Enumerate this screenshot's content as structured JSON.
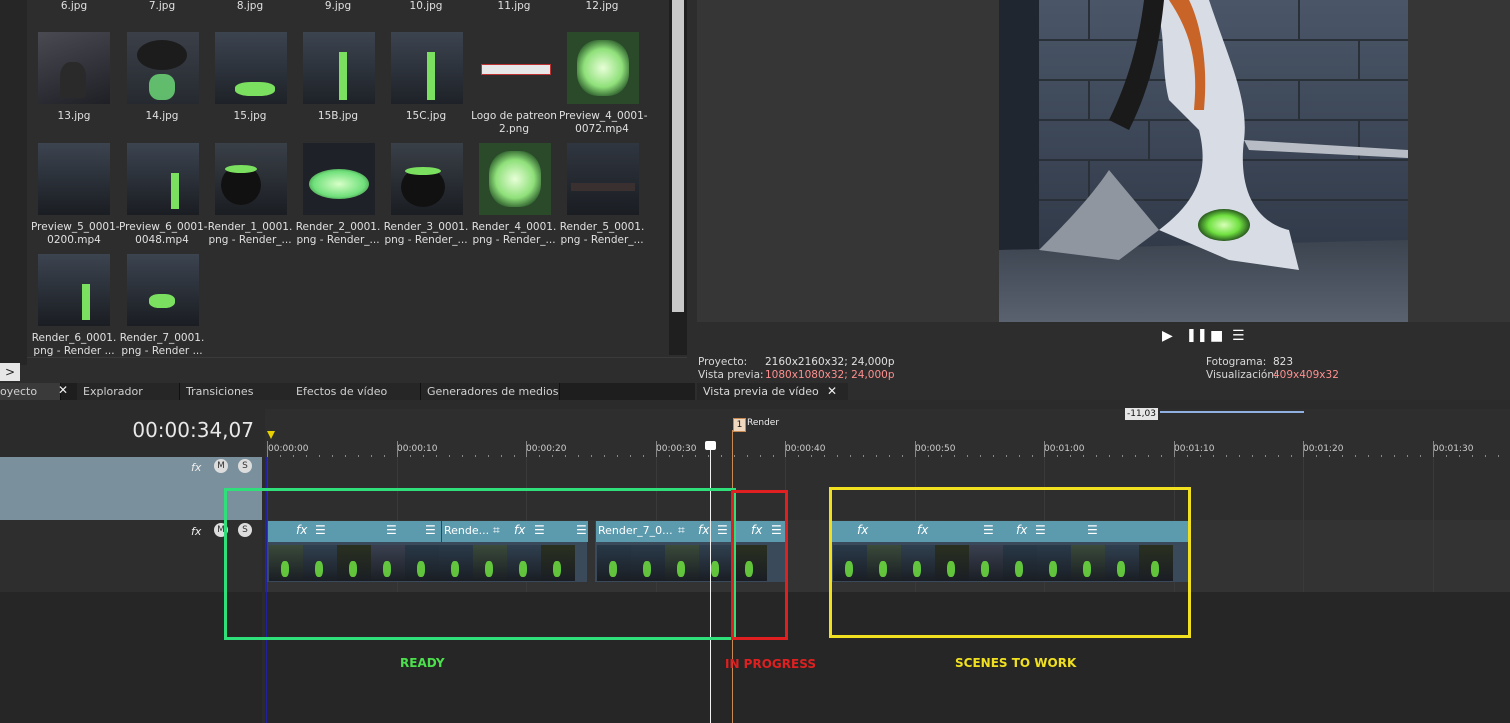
{
  "media": {
    "files": [
      {
        "name": "6.jpg"
      },
      {
        "name": "7.jpg"
      },
      {
        "name": "8.jpg"
      },
      {
        "name": "9.jpg"
      },
      {
        "name": "10.jpg"
      },
      {
        "name": "11.jpg"
      },
      {
        "name": "12.jpg"
      },
      {
        "name": "13.jpg"
      },
      {
        "name": "14.jpg"
      },
      {
        "name": "15.jpg"
      },
      {
        "name": "15B.jpg"
      },
      {
        "name": "15C.jpg"
      },
      {
        "name": "Logo de patreon\n2.png"
      },
      {
        "name": "Preview_4_0001-\n0072.mp4"
      },
      {
        "name": "Preview_5_0001-\n0200.mp4"
      },
      {
        "name": "Preview_6_0001-\n0048.mp4"
      },
      {
        "name": "Render_1_0001.\npng - Render_..."
      },
      {
        "name": "Render_2_0001.\npng - Render_..."
      },
      {
        "name": "Render_3_0001.\npng - Render_..."
      },
      {
        "name": "Render_4_0001.\npng - Render_..."
      },
      {
        "name": "Render_5_0001.\npng - Render_..."
      },
      {
        "name": "Render_6_0001.\npng - Render ..."
      },
      {
        "name": "Render_7_0001.\npng - Render ..."
      }
    ],
    "expand": ">"
  },
  "tabs": {
    "project": "oyecto",
    "explorer": "Explorador",
    "transitions": "Transiciones",
    "video_fx": "Efectos de vídeo",
    "generators": "Generadores de medios",
    "close": "✕"
  },
  "preview": {
    "tab": "Vista previa de vídeo",
    "close": "✕",
    "project_label": "Proyecto:",
    "project_value": "2160x2160x32; 24,000p",
    "preview_label": "Vista previa:",
    "preview_value": "1080x1080x32; 24,000p",
    "frame_label": "Fotograma:",
    "frame_value": "823",
    "display_label": "Visualización:",
    "display_value": "409x409x32"
  },
  "timeline": {
    "timecode": "00:00:34,07",
    "marker_num": "1",
    "marker_label": "Render",
    "loop_value": "-11,03",
    "ruler": [
      "00:00:00",
      "00:00:10",
      "00:00:20",
      "00:00:30",
      "00:00:40",
      "00:00:50",
      "00:01:00",
      "00:01:10",
      "00:01:20",
      "00:01:30"
    ],
    "clips": {
      "c1": "Rende...",
      "c2": "Render_7_0..."
    }
  },
  "annotations": {
    "ready": "READY",
    "in_progress": "IN PROGRESS",
    "scenes": "SCENES TO WORK",
    "colors": {
      "ready": "#2fe07a",
      "in_progress": "#e02020",
      "scenes": "#f0e020"
    }
  }
}
